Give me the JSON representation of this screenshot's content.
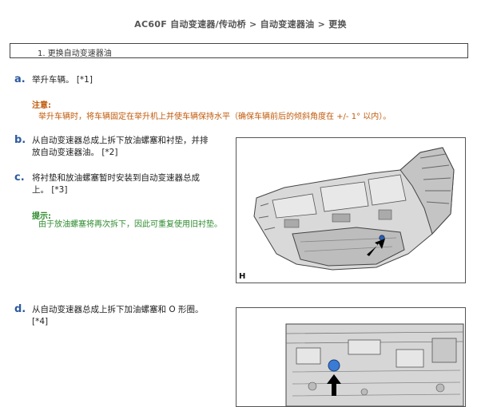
{
  "header": {
    "title": "AC60F 自动变速器/传动桥 > 自动变速器油 > 更换"
  },
  "section": {
    "label": "1. 更换自动变速器油"
  },
  "steps": [
    {
      "letter": "a.",
      "text": "举升车辆。 [*1]"
    },
    {
      "letter": "b.",
      "text_line1": "从自动变速器总成上拆下放油螺塞和衬垫，并排",
      "text_line2": "放自动变速器油。 [*2]"
    },
    {
      "letter": "c.",
      "text_line1": "将衬垫和放油螺塞暂时安装到自动变速器总成",
      "text_line2": "上。 [*3]"
    },
    {
      "letter": "d.",
      "text_line1": "从自动变速器总成上拆下加油螺塞和 O 形圈。",
      "text_line2": "[*4]"
    }
  ],
  "caution": {
    "label": "注意:",
    "text": "举升车辆时，将车辆固定在举升机上并使车辆保持水平（确保车辆前后的倾斜角度在 +/- 1° 以内）。"
  },
  "hint": {
    "label": "提示:",
    "text": "由于放油螺塞将再次拆下，因此可重复使用旧衬垫。"
  },
  "figures": [
    {
      "label": "H",
      "icon": "transmission-illustration"
    },
    {
      "label": "",
      "icon": "fill-plug-closeup-illustration"
    }
  ],
  "colors": {
    "step_letter": "#2c5a9e",
    "caution": "#c05a0a",
    "hint": "#2e8b2e",
    "marker": "#3a7bd5"
  }
}
